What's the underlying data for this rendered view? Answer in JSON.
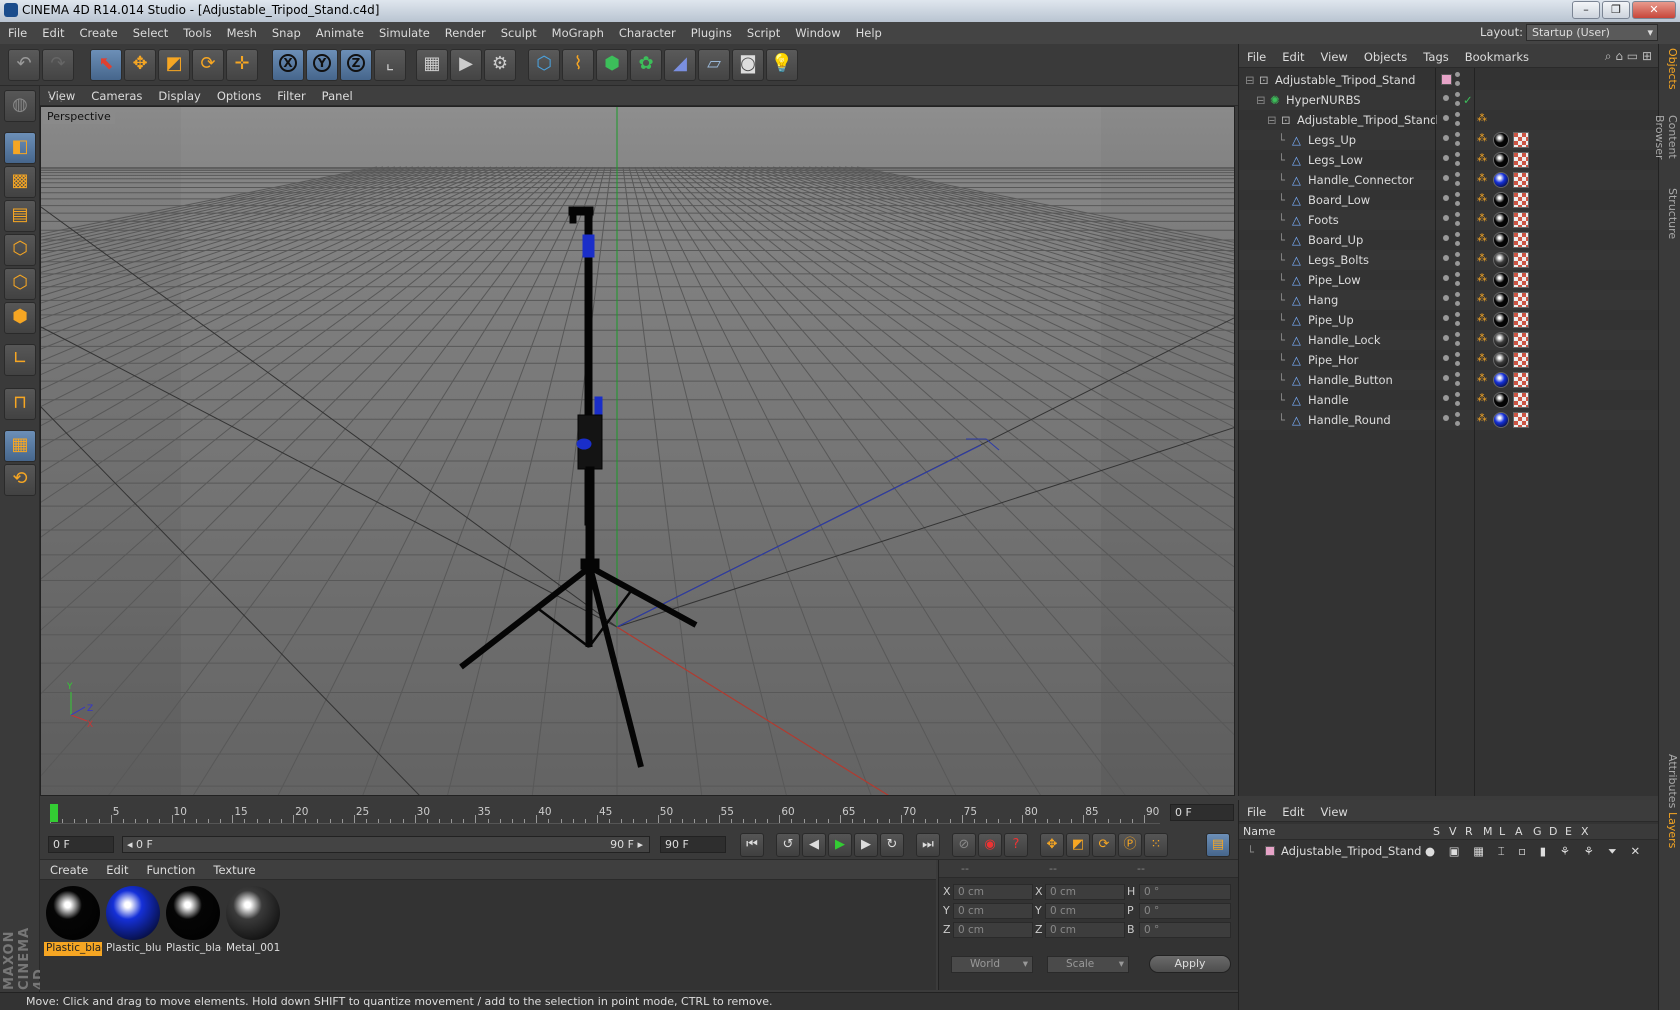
{
  "window": {
    "title": "CINEMA 4D R14.014 Studio - [Adjustable_Tripod_Stand.c4d]",
    "minimize": "–",
    "maximize": "❐",
    "close": "✕"
  },
  "menubar": [
    "File",
    "Edit",
    "Create",
    "Select",
    "Tools",
    "Mesh",
    "Snap",
    "Animate",
    "Simulate",
    "Render",
    "Sculpt",
    "MoGraph",
    "Character",
    "Plugins",
    "Script",
    "Window",
    "Help"
  ],
  "layout": {
    "label": "Layout:",
    "value": "Startup (User)"
  },
  "toolbar": {
    "icons": [
      "undo-icon",
      "redo-icon",
      "live-selection-icon",
      "move-icon",
      "scale-icon",
      "rotate-icon",
      "add-icon",
      "x-axis-icon",
      "y-axis-icon",
      "z-axis-icon",
      "coordinate-system-icon",
      "render-view-icon",
      "render-picture-viewer-icon",
      "edit-render-settings-icon",
      "cube-icon",
      "spline-icon",
      "nurbs-icon",
      "array-icon",
      "deformer-icon",
      "floor-icon",
      "camera-icon",
      "light-icon"
    ],
    "axis_labels": [
      "X",
      "Y",
      "Z"
    ]
  },
  "viewport": {
    "menu": [
      "View",
      "Cameras",
      "Display",
      "Options",
      "Filter",
      "Panel"
    ],
    "label": "Perspective",
    "axes": {
      "x": "X",
      "y": "Y",
      "z": "Z"
    }
  },
  "timeline": {
    "ticks": [
      "0",
      "5",
      "10",
      "15",
      "20",
      "25",
      "30",
      "35",
      "40",
      "45",
      "50",
      "55",
      "60",
      "65",
      "70",
      "75",
      "80",
      "85",
      "90"
    ],
    "current_frame": "0 F",
    "start_frame": "0 F",
    "range_start": "◂ 0 F",
    "range_end": "90 F ▸",
    "end_frame": "90 F"
  },
  "material_menu": [
    "Create",
    "Edit",
    "Function",
    "Texture"
  ],
  "materials": [
    {
      "name": "Plastic_blac",
      "color": "#050505",
      "selected": true
    },
    {
      "name": "Plastic_blu",
      "color": "#1530d8",
      "selected": false
    },
    {
      "name": "Plastic_blac",
      "color": "#050505",
      "selected": false
    },
    {
      "name": "Metal_001",
      "color": "#3a3a3a",
      "selected": false
    }
  ],
  "coordinates": {
    "headers": [
      "--",
      "--",
      "--"
    ],
    "rows": [
      {
        "a": "X",
        "av": "0 cm",
        "b": "X",
        "bv": "0 cm",
        "c": "H",
        "cv": "0 °"
      },
      {
        "a": "Y",
        "av": "0 cm",
        "b": "Y",
        "bv": "0 cm",
        "c": "P",
        "cv": "0 °"
      },
      {
        "a": "Z",
        "av": "0 cm",
        "b": "Z",
        "bv": "0 cm",
        "c": "B",
        "cv": "0 °"
      }
    ],
    "mode1": "World",
    "mode2": "Scale",
    "apply": "Apply"
  },
  "status": "Move: Click and drag to move elements. Hold down SHIFT to quantize movement / add to the selection in point mode, CTRL to remove.",
  "objects_menu": [
    "File",
    "Edit",
    "View",
    "Objects",
    "Tags",
    "Bookmarks"
  ],
  "objects": [
    {
      "name": "Adjustable_Tripod_Stand",
      "level": 0,
      "type": "null"
    },
    {
      "name": "HyperNURBS",
      "level": 1,
      "type": "nurbs"
    },
    {
      "name": "Adjustable_Tripod_Stand",
      "level": 2,
      "type": "null"
    },
    {
      "name": "Legs_Up",
      "level": 3,
      "type": "poly",
      "mat": "#050505"
    },
    {
      "name": "Legs_Low",
      "level": 3,
      "type": "poly",
      "mat": "#050505"
    },
    {
      "name": "Handle_Connector",
      "level": 3,
      "type": "poly",
      "mat": "#1530d8"
    },
    {
      "name": "Board_Low",
      "level": 3,
      "type": "poly",
      "mat": "#050505"
    },
    {
      "name": "Foots",
      "level": 3,
      "type": "poly",
      "mat": "#050505"
    },
    {
      "name": "Board_Up",
      "level": 3,
      "type": "poly",
      "mat": "#050505"
    },
    {
      "name": "Legs_Bolts",
      "level": 3,
      "type": "poly",
      "mat": "#3a3a3a"
    },
    {
      "name": "Pipe_Low",
      "level": 3,
      "type": "poly",
      "mat": "#050505"
    },
    {
      "name": "Hang",
      "level": 3,
      "type": "poly",
      "mat": "#050505"
    },
    {
      "name": "Pipe_Up",
      "level": 3,
      "type": "poly",
      "mat": "#050505"
    },
    {
      "name": "Handle_Lock",
      "level": 3,
      "type": "poly",
      "mat": "#3a3a3a"
    },
    {
      "name": "Pipe_Hor",
      "level": 3,
      "type": "poly",
      "mat": "#3a3a3a"
    },
    {
      "name": "Handle_Button",
      "level": 3,
      "type": "poly",
      "mat": "#1530d8"
    },
    {
      "name": "Handle",
      "level": 3,
      "type": "poly",
      "mat": "#050505"
    },
    {
      "name": "Handle_Round",
      "level": 3,
      "type": "poly",
      "mat": "#1530d8"
    }
  ],
  "attributes_menu": [
    "File",
    "Edit",
    "View"
  ],
  "attributes_columns": [
    "Name",
    "S",
    "V",
    "R",
    "M",
    "L",
    "A",
    "G",
    "D",
    "E",
    "X"
  ],
  "attributes_row": "Adjustable_Tripod_Stand",
  "right_tabs": [
    "Objects",
    "Content Browser",
    "Structure",
    "Attributes",
    "Layers"
  ]
}
